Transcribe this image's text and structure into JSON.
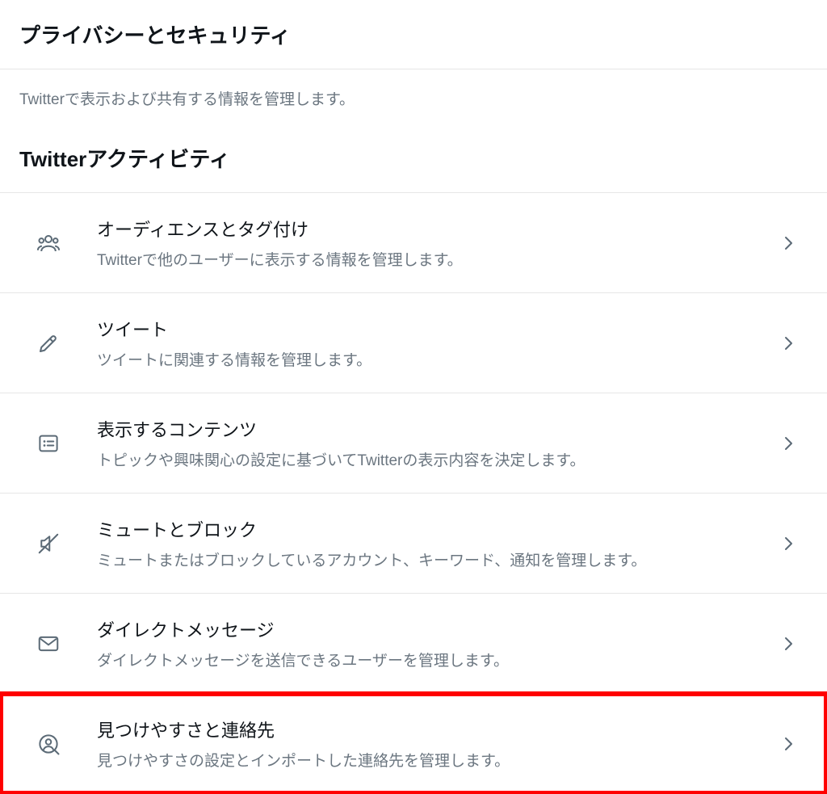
{
  "header": {
    "title": "プライバシーとセキュリティ",
    "description": "Twitterで表示および共有する情報を管理します。"
  },
  "section": {
    "title": "Twitterアクティビティ"
  },
  "items": [
    {
      "icon": "people",
      "title": "オーディエンスとタグ付け",
      "desc": "Twitterで他のユーザーに表示する情報を管理します。",
      "highlight": false
    },
    {
      "icon": "pencil",
      "title": "ツイート",
      "desc": "ツイートに関連する情報を管理します。",
      "highlight": false
    },
    {
      "icon": "list",
      "title": "表示するコンテンツ",
      "desc": "トピックや興味関心の設定に基づいてTwitterの表示内容を決定します。",
      "highlight": false
    },
    {
      "icon": "mute",
      "title": "ミュートとブロック",
      "desc": "ミュートまたはブロックしているアカウント、キーワード、通知を管理します。",
      "highlight": false
    },
    {
      "icon": "envelope",
      "title": "ダイレクトメッセージ",
      "desc": "ダイレクトメッセージを送信できるユーザーを管理します。",
      "highlight": false
    },
    {
      "icon": "person-search",
      "title": "見つけやすさと連絡先",
      "desc": "見つけやすさの設定とインポートした連絡先を管理します。",
      "highlight": true
    }
  ]
}
